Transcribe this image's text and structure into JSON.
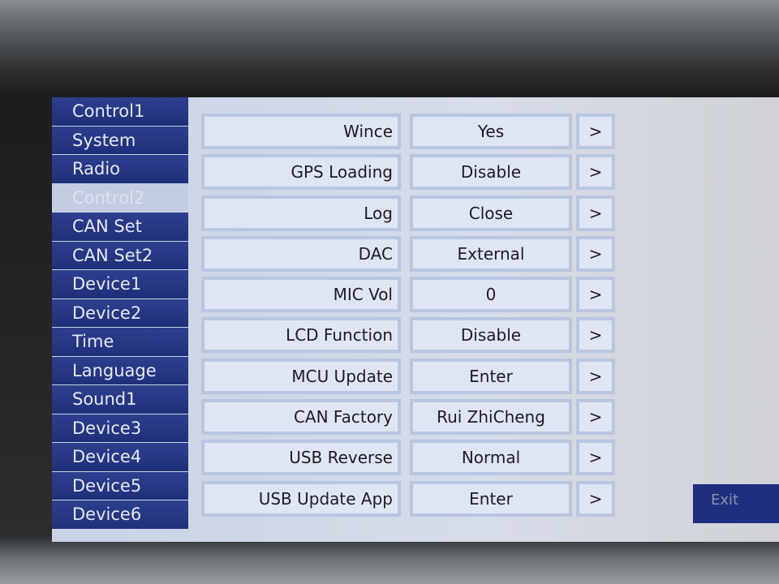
{
  "sidebar": {
    "items": [
      {
        "label": "Control1"
      },
      {
        "label": "System"
      },
      {
        "label": "Radio"
      },
      {
        "label": "Control2",
        "active": true
      },
      {
        "label": "CAN Set"
      },
      {
        "label": "CAN Set2"
      },
      {
        "label": "Device1"
      },
      {
        "label": "Device2"
      },
      {
        "label": "Time"
      },
      {
        "label": "Language"
      },
      {
        "label": "Sound1"
      },
      {
        "label": "Device3"
      },
      {
        "label": "Device4"
      },
      {
        "label": "Device5"
      },
      {
        "label": "Device6"
      }
    ]
  },
  "settings": [
    {
      "label": "Wince",
      "value": "Yes",
      "arrow": ">"
    },
    {
      "label": "GPS Loading",
      "value": "Disable",
      "arrow": ">"
    },
    {
      "label": "Log",
      "value": "Close",
      "arrow": ">"
    },
    {
      "label": "DAC",
      "value": "External",
      "arrow": ">"
    },
    {
      "label": "MIC Vol",
      "value": "0",
      "arrow": ">"
    },
    {
      "label": "LCD Function",
      "value": "Disable",
      "arrow": ">"
    },
    {
      "label": "MCU Update",
      "value": "Enter",
      "arrow": ">"
    },
    {
      "label": "CAN Factory",
      "value": "Rui ZhiCheng",
      "arrow": ">"
    },
    {
      "label": "USB Reverse",
      "value": "Normal",
      "arrow": ">"
    },
    {
      "label": "USB Update App",
      "value": "Enter",
      "arrow": ">"
    }
  ],
  "exit_label": "Exit",
  "colors": {
    "sidebar": "#1f2f7a",
    "active": "#c3cce0",
    "panel": "#dfe5f2"
  }
}
